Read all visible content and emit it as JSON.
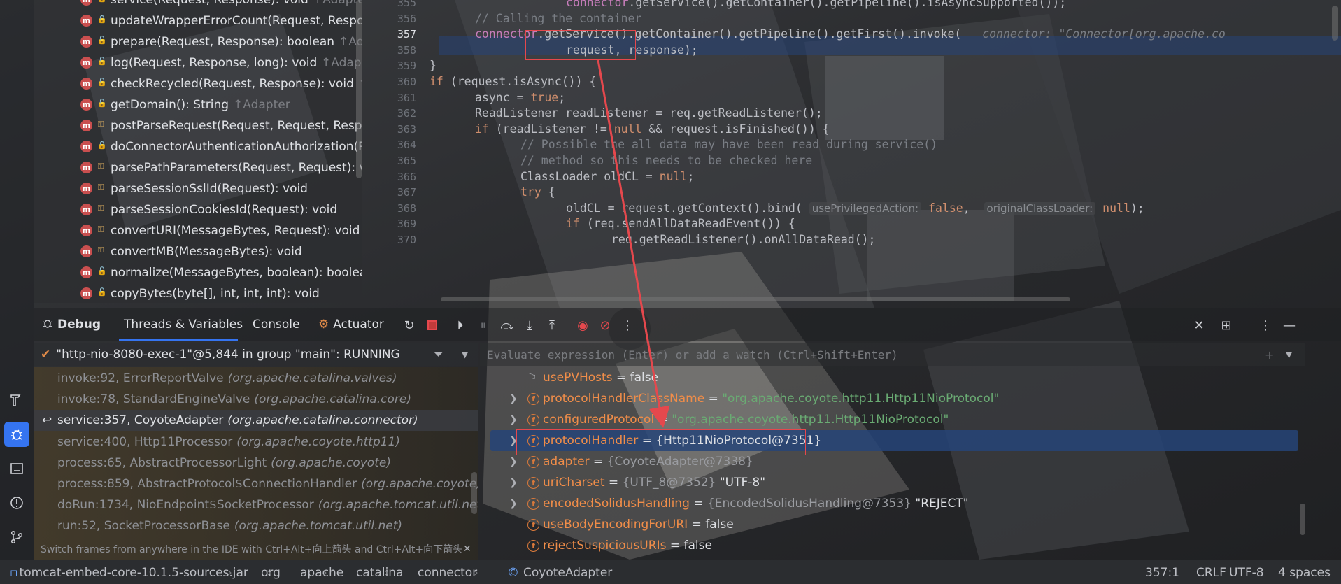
{
  "structure": {
    "methods": [
      {
        "name": "service(Request, Response): void",
        "super": "↑Adapter",
        "vis": "pub"
      },
      {
        "name": "updateWrapperErrorCount(Request, Response)",
        "super": "",
        "vis": "pri"
      },
      {
        "name": "prepare(Request, Response): boolean",
        "super": "↑Adapter",
        "vis": "pub"
      },
      {
        "name": "log(Request, Response, long): void",
        "super": "↑Adapter",
        "vis": "pub"
      },
      {
        "name": "checkRecycled(Request, Response): void",
        "super": "↑Ada",
        "vis": "pub"
      },
      {
        "name": "getDomain(): String",
        "super": "↑Adapter",
        "vis": "pub"
      },
      {
        "name": "postParseRequest(Request, Request, Response",
        "super": "",
        "vis": "pkg"
      },
      {
        "name": "doConnectorAuthenticationAuthorization(Requ",
        "super": "",
        "vis": "pri"
      },
      {
        "name": "parsePathParameters(Request, Request): void",
        "super": "",
        "vis": "pkg"
      },
      {
        "name": "parseSessionSslId(Request): void",
        "super": "",
        "vis": "pkg"
      },
      {
        "name": "parseSessionCookiesId(Request): void",
        "super": "",
        "vis": "pkg"
      },
      {
        "name": "convertURI(MessageBytes, Request): void",
        "super": "",
        "vis": "pkg"
      },
      {
        "name": "convertMB(MessageBytes): void",
        "super": "",
        "vis": "pkg"
      },
      {
        "name": "normalize(MessageBytes, boolean): boolean",
        "super": "",
        "vis": "pub"
      },
      {
        "name": "copyBytes(byte[], int, int, int): void",
        "super": "",
        "vis": "pub"
      }
    ],
    "method_icon": "m",
    "public_icon": "unlock-icon",
    "private_icon": "lock-icon",
    "package_icon": "key-icon"
  },
  "editor": {
    "lines": [
      {
        "num": "355",
        "indent": 3,
        "html": "<span class=\"fld\">connector</span>.getService().getContainer().getPipeline().isAsyncSupported());"
      },
      {
        "num": "356",
        "indent": 1,
        "html": "<span class=\"cm\">// Calling the container</span>"
      },
      {
        "num": "357",
        "indent": 1,
        "html": "<span class=\"fld\">connector</span>.getService().getContainer().getPipeline().getFirst().invoke(   <span class=\"inl\">connector: \"Connector[org.apache.co</span>"
      },
      {
        "num": "358",
        "indent": 3,
        "html": "request, response);"
      },
      {
        "num": "359",
        "indent": 0,
        "html": "}"
      },
      {
        "num": "360",
        "indent": 0,
        "html": "<span class=\"kw\">if</span> (request.isAsync()) {"
      },
      {
        "num": "361",
        "indent": 1,
        "html": "async = <span class=\"kw\">true</span>;"
      },
      {
        "num": "362",
        "indent": 1,
        "html": "ReadListener readListener = req.getReadListener();"
      },
      {
        "num": "363",
        "indent": 1,
        "html": "<span class=\"kw\">if</span> (readListener != <span class=\"kw\">null</span> &amp;&amp; request.isFinished()) {"
      },
      {
        "num": "364",
        "indent": 2,
        "html": "<span class=\"cm\">// Possible the all data may have been read during service()</span>"
      },
      {
        "num": "365",
        "indent": 2,
        "html": "<span class=\"cm\">// method so this needs to be checked here</span>"
      },
      {
        "num": "366",
        "indent": 2,
        "html": "ClassLoader oldCL = <span class=\"kw\">null</span>;"
      },
      {
        "num": "367",
        "indent": 2,
        "html": "<span class=\"kw\">try</span> {"
      },
      {
        "num": "368",
        "indent": 3,
        "html": "oldCL = request.getContext().bind( <span class=\"hint\">usePrivilegedAction:</span> <span class=\"kw\">false</span>,  <span class=\"hint\">originalClassLoader:</span> <span class=\"kw\">null</span>);"
      },
      {
        "num": "369",
        "indent": 3,
        "html": "<span class=\"kw\">if</span> (req.sendAllDataReadEvent()) {"
      },
      {
        "num": "370",
        "indent": 4,
        "html": "req.getReadListener().onAllDataRead();"
      }
    ],
    "current_line": "357"
  },
  "debug": {
    "tool_label": "Debug",
    "tabs": [
      "Threads & Variables",
      "Console",
      "Actuator"
    ],
    "thread": "\"http-nio-8080-exec-1\"@5,844 in group \"main\": RUNNING",
    "frames": [
      {
        "method": "invoke:92, ErrorReportValve",
        "pkg": "(org.apache.catalina.valves)",
        "state": "dim"
      },
      {
        "method": "invoke:78, StandardEngineValve",
        "pkg": "(org.apache.catalina.core)",
        "state": "dim"
      },
      {
        "method": "service:357, CoyoteAdapter",
        "pkg": "(org.apache.catalina.connector)",
        "state": "sel"
      },
      {
        "method": "service:400, Http11Processor",
        "pkg": "(org.apache.coyote.http11)",
        "state": "dim"
      },
      {
        "method": "process:65, AbstractProcessorLight",
        "pkg": "(org.apache.coyote)",
        "state": "dim"
      },
      {
        "method": "process:859, AbstractProtocol$ConnectionHandler",
        "pkg": "(org.apache.coyote)",
        "state": "dim"
      },
      {
        "method": "doRun:1734, NioEndpoint$SocketProcessor",
        "pkg": "(org.apache.tomcat.util.net)",
        "state": "dim"
      },
      {
        "method": "run:52, SocketProcessorBase",
        "pkg": "(org.apache.tomcat.util.net)",
        "state": "dim"
      }
    ],
    "tip": "Switch frames from anywhere in the IDE with Ctrl+Alt+向上箭头 and Ctrl+Alt+向下箭头",
    "evaluate_placeholder": "Evaluate expression (Enter) or add a watch (Ctrl+Shift+Enter)",
    "variables": [
      {
        "name": "usePVHosts",
        "eq": " = ",
        "val": "false",
        "kind": "plain",
        "expand": false,
        "icon": "flag",
        "state": ""
      },
      {
        "name": "protocolHandlerClassName",
        "eq": " = ",
        "val": "\"org.apache.coyote.http11.Http11NioProtocol\"",
        "kind": "str",
        "expand": true,
        "icon": "f",
        "state": ""
      },
      {
        "name": "configuredProtocol",
        "eq": " = ",
        "val": "\"org.apache.coyote.http11.Http11NioProtocol\"",
        "kind": "str",
        "expand": true,
        "icon": "f",
        "state": ""
      },
      {
        "name": "protocolHandler",
        "eq": " = ",
        "val": "{Http11NioProtocol@7351}",
        "kind": "plain",
        "expand": true,
        "icon": "f",
        "state": "sel"
      },
      {
        "name": "adapter",
        "eq": " = ",
        "val": "{CoyoteAdapter@7338}",
        "kind": "ref",
        "expand": true,
        "icon": "f",
        "state": ""
      },
      {
        "name": "uriCharset",
        "eq": " = ",
        "val": "{UTF_8@7352}",
        "extra": " \"UTF-8\"",
        "kind": "ref",
        "expand": true,
        "icon": "f",
        "state": ""
      },
      {
        "name": "encodedSolidusHandling",
        "eq": " = ",
        "val": "{EncodedSolidusHandling@7353}",
        "extra": " \"REJECT\"",
        "kind": "ref",
        "expand": true,
        "icon": "f",
        "state": ""
      },
      {
        "name": "useBodyEncodingForURI",
        "eq": " = ",
        "val": "false",
        "kind": "plain",
        "expand": false,
        "icon": "f",
        "state": ""
      },
      {
        "name": "rejectSuspiciousURIs",
        "eq": " = ",
        "val": "false",
        "kind": "plain",
        "expand": false,
        "icon": "f",
        "state": ""
      }
    ]
  },
  "status": {
    "crumbs": [
      "tomcat-embed-core-10.1.5-sources.jar",
      "org",
      "apache",
      "catalina",
      "connector",
      "CoyoteAdapter"
    ],
    "position": "357:1",
    "line_sep": "CRLF",
    "encoding": "UTF-8",
    "indent": "4 spaces"
  },
  "colors": {
    "accent": "#3574f0",
    "annotation": "#e5484d",
    "selection": "#264478"
  }
}
